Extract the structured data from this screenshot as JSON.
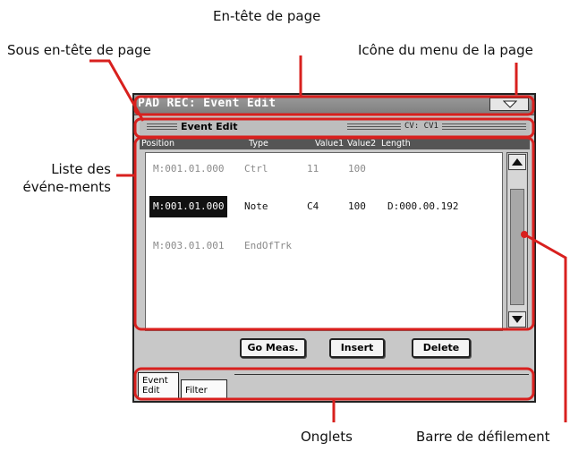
{
  "callouts": {
    "header": "En-tête de page",
    "subheader": "Sous en-tête de page",
    "menu_icon": "Icône du menu de la page",
    "event_list": "Liste des événe-ments",
    "tabs": "Onglets",
    "scrollbar": "Barre de défilement"
  },
  "screen": {
    "title": "PAD REC: Event Edit",
    "subheader": {
      "title": "Event Edit",
      "cv": "CV: CV1"
    },
    "columns": [
      "Position",
      "Type",
      "Value1",
      "Value2",
      "Length"
    ],
    "events": [
      {
        "position": "M:001.01.000",
        "type": "Ctrl",
        "value1": "11",
        "value2": "100",
        "length": ""
      },
      {
        "position": "M:001.01.000",
        "type": "Note",
        "value1": "C4",
        "value2": "100",
        "length": "D:000.00.192"
      },
      {
        "position": "M:003.01.001",
        "type": "EndOfTrk",
        "value1": "",
        "value2": "",
        "length": ""
      }
    ],
    "buttons": {
      "go_meas": "Go Meas.",
      "insert": "Insert",
      "delete": "Delete"
    },
    "tabs": {
      "event_edit": "Event Edit",
      "filter": "Filter"
    }
  },
  "colors": {
    "annotation": "#d8201e",
    "selected": "#111111",
    "dim_text": "#8a8a8a"
  }
}
